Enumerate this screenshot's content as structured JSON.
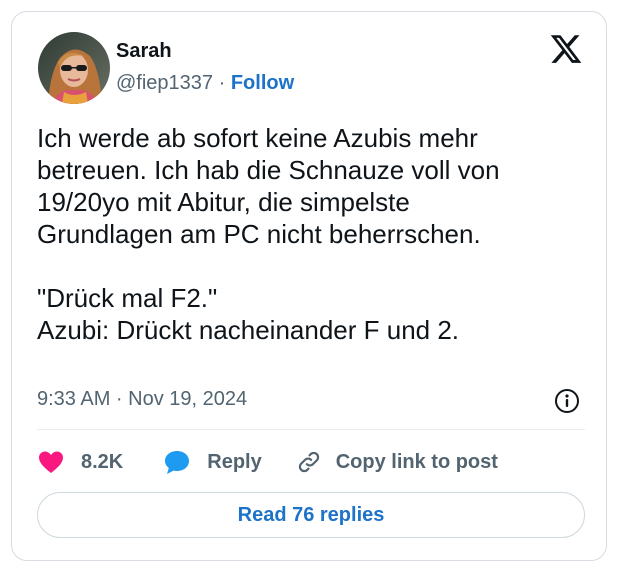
{
  "author": {
    "name": "Sarah",
    "handle": "@fiep1337",
    "separator": "·",
    "follow_label": "Follow"
  },
  "tweet": {
    "paragraph1": [
      "Ich werde ab sofort keine Azubis mehr",
      "betreuen. Ich hab die Schnauze voll von",
      "19/20yo mit Abitur, die simpelste",
      "Grundlagen am PC nicht beherrschen."
    ],
    "paragraph2": [
      "\"Drück mal F2.\"",
      "Azubi: Drückt nacheinander F und 2."
    ],
    "timestamp": "9:33 AM · Nov 19, 2024"
  },
  "actions": {
    "like_count": "8.2K",
    "reply_label": "Reply",
    "copy_label": "Copy link to post"
  },
  "read_replies_label": "Read 76 replies",
  "icons": {
    "logo": "x-logo-icon",
    "info": "info-icon",
    "like": "heart-icon",
    "reply": "speech-bubble-icon",
    "copy": "link-icon"
  },
  "colors": {
    "link_blue": "#1d73c9",
    "heart_pink": "#f91880",
    "reply_blue": "#1d9bf0",
    "secondary_text": "#536471"
  }
}
